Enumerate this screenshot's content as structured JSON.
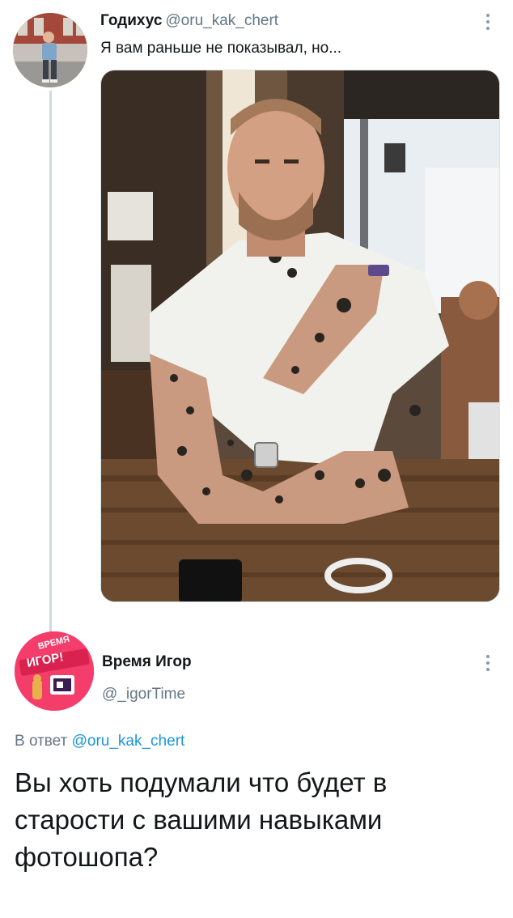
{
  "parent_tweet": {
    "author_name": "Годихус",
    "author_handle": "@oru_kak_chert",
    "text": "Я вам раньше не показывал, но...",
    "more_icon": "more-vertical-icon"
  },
  "reply_tweet": {
    "author_name": "Время Игор",
    "author_handle": "@_igorTime",
    "reply_prefix": "В ответ",
    "reply_mention": "@oru_kak_chert",
    "text": "Вы хоть подумали что будет в старости с вашими навыками фотошопа?",
    "more_icon": "more-vertical-icon",
    "avatar_lettering": [
      "ВРЕМЯ",
      "ИГОР!"
    ]
  },
  "colors": {
    "handle_gray": "#657786",
    "link_blue": "#1b95e0",
    "thread_line": "#cfd9de",
    "avatar2_bg": "#f53d6b"
  }
}
